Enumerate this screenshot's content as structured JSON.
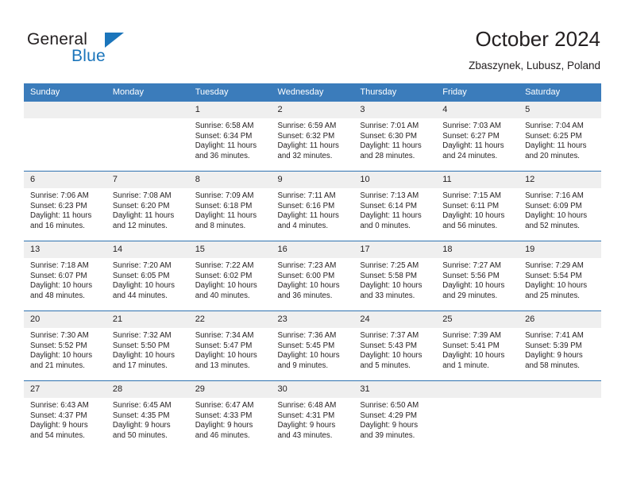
{
  "brand": {
    "name_top": "General",
    "name_bottom": "Blue",
    "accent_color": "#1b75bb"
  },
  "header": {
    "title": "October 2024",
    "location": "Zbaszynek, Lubusz, Poland",
    "header_bg_color": "#3b7cbb",
    "row_divider_color": "#2e72b0",
    "daynum_bg_color": "#efefef"
  },
  "weekday_headers": [
    "Sunday",
    "Monday",
    "Tuesday",
    "Wednesday",
    "Thursday",
    "Friday",
    "Saturday"
  ],
  "labels": {
    "sunrise": "Sunrise:",
    "sunset": "Sunset:",
    "daylight": "Daylight:"
  },
  "weeks": [
    [
      {
        "day": "",
        "empty": true,
        "sunrise": "",
        "sunset": "",
        "daylight_line1": "",
        "daylight_line2": ""
      },
      {
        "day": "",
        "empty": true,
        "sunrise": "",
        "sunset": "",
        "daylight_line1": "",
        "daylight_line2": ""
      },
      {
        "day": "1",
        "empty": false,
        "sunrise": "Sunrise: 6:58 AM",
        "sunset": "Sunset: 6:34 PM",
        "daylight_line1": "Daylight: 11 hours",
        "daylight_line2": "and 36 minutes."
      },
      {
        "day": "2",
        "empty": false,
        "sunrise": "Sunrise: 6:59 AM",
        "sunset": "Sunset: 6:32 PM",
        "daylight_line1": "Daylight: 11 hours",
        "daylight_line2": "and 32 minutes."
      },
      {
        "day": "3",
        "empty": false,
        "sunrise": "Sunrise: 7:01 AM",
        "sunset": "Sunset: 6:30 PM",
        "daylight_line1": "Daylight: 11 hours",
        "daylight_line2": "and 28 minutes."
      },
      {
        "day": "4",
        "empty": false,
        "sunrise": "Sunrise: 7:03 AM",
        "sunset": "Sunset: 6:27 PM",
        "daylight_line1": "Daylight: 11 hours",
        "daylight_line2": "and 24 minutes."
      },
      {
        "day": "5",
        "empty": false,
        "sunrise": "Sunrise: 7:04 AM",
        "sunset": "Sunset: 6:25 PM",
        "daylight_line1": "Daylight: 11 hours",
        "daylight_line2": "and 20 minutes."
      }
    ],
    [
      {
        "day": "6",
        "empty": false,
        "sunrise": "Sunrise: 7:06 AM",
        "sunset": "Sunset: 6:23 PM",
        "daylight_line1": "Daylight: 11 hours",
        "daylight_line2": "and 16 minutes."
      },
      {
        "day": "7",
        "empty": false,
        "sunrise": "Sunrise: 7:08 AM",
        "sunset": "Sunset: 6:20 PM",
        "daylight_line1": "Daylight: 11 hours",
        "daylight_line2": "and 12 minutes."
      },
      {
        "day": "8",
        "empty": false,
        "sunrise": "Sunrise: 7:09 AM",
        "sunset": "Sunset: 6:18 PM",
        "daylight_line1": "Daylight: 11 hours",
        "daylight_line2": "and 8 minutes."
      },
      {
        "day": "9",
        "empty": false,
        "sunrise": "Sunrise: 7:11 AM",
        "sunset": "Sunset: 6:16 PM",
        "daylight_line1": "Daylight: 11 hours",
        "daylight_line2": "and 4 minutes."
      },
      {
        "day": "10",
        "empty": false,
        "sunrise": "Sunrise: 7:13 AM",
        "sunset": "Sunset: 6:14 PM",
        "daylight_line1": "Daylight: 11 hours",
        "daylight_line2": "and 0 minutes."
      },
      {
        "day": "11",
        "empty": false,
        "sunrise": "Sunrise: 7:15 AM",
        "sunset": "Sunset: 6:11 PM",
        "daylight_line1": "Daylight: 10 hours",
        "daylight_line2": "and 56 minutes."
      },
      {
        "day": "12",
        "empty": false,
        "sunrise": "Sunrise: 7:16 AM",
        "sunset": "Sunset: 6:09 PM",
        "daylight_line1": "Daylight: 10 hours",
        "daylight_line2": "and 52 minutes."
      }
    ],
    [
      {
        "day": "13",
        "empty": false,
        "sunrise": "Sunrise: 7:18 AM",
        "sunset": "Sunset: 6:07 PM",
        "daylight_line1": "Daylight: 10 hours",
        "daylight_line2": "and 48 minutes."
      },
      {
        "day": "14",
        "empty": false,
        "sunrise": "Sunrise: 7:20 AM",
        "sunset": "Sunset: 6:05 PM",
        "daylight_line1": "Daylight: 10 hours",
        "daylight_line2": "and 44 minutes."
      },
      {
        "day": "15",
        "empty": false,
        "sunrise": "Sunrise: 7:22 AM",
        "sunset": "Sunset: 6:02 PM",
        "daylight_line1": "Daylight: 10 hours",
        "daylight_line2": "and 40 minutes."
      },
      {
        "day": "16",
        "empty": false,
        "sunrise": "Sunrise: 7:23 AM",
        "sunset": "Sunset: 6:00 PM",
        "daylight_line1": "Daylight: 10 hours",
        "daylight_line2": "and 36 minutes."
      },
      {
        "day": "17",
        "empty": false,
        "sunrise": "Sunrise: 7:25 AM",
        "sunset": "Sunset: 5:58 PM",
        "daylight_line1": "Daylight: 10 hours",
        "daylight_line2": "and 33 minutes."
      },
      {
        "day": "18",
        "empty": false,
        "sunrise": "Sunrise: 7:27 AM",
        "sunset": "Sunset: 5:56 PM",
        "daylight_line1": "Daylight: 10 hours",
        "daylight_line2": "and 29 minutes."
      },
      {
        "day": "19",
        "empty": false,
        "sunrise": "Sunrise: 7:29 AM",
        "sunset": "Sunset: 5:54 PM",
        "daylight_line1": "Daylight: 10 hours",
        "daylight_line2": "and 25 minutes."
      }
    ],
    [
      {
        "day": "20",
        "empty": false,
        "sunrise": "Sunrise: 7:30 AM",
        "sunset": "Sunset: 5:52 PM",
        "daylight_line1": "Daylight: 10 hours",
        "daylight_line2": "and 21 minutes."
      },
      {
        "day": "21",
        "empty": false,
        "sunrise": "Sunrise: 7:32 AM",
        "sunset": "Sunset: 5:50 PM",
        "daylight_line1": "Daylight: 10 hours",
        "daylight_line2": "and 17 minutes."
      },
      {
        "day": "22",
        "empty": false,
        "sunrise": "Sunrise: 7:34 AM",
        "sunset": "Sunset: 5:47 PM",
        "daylight_line1": "Daylight: 10 hours",
        "daylight_line2": "and 13 minutes."
      },
      {
        "day": "23",
        "empty": false,
        "sunrise": "Sunrise: 7:36 AM",
        "sunset": "Sunset: 5:45 PM",
        "daylight_line1": "Daylight: 10 hours",
        "daylight_line2": "and 9 minutes."
      },
      {
        "day": "24",
        "empty": false,
        "sunrise": "Sunrise: 7:37 AM",
        "sunset": "Sunset: 5:43 PM",
        "daylight_line1": "Daylight: 10 hours",
        "daylight_line2": "and 5 minutes."
      },
      {
        "day": "25",
        "empty": false,
        "sunrise": "Sunrise: 7:39 AM",
        "sunset": "Sunset: 5:41 PM",
        "daylight_line1": "Daylight: 10 hours",
        "daylight_line2": "and 1 minute."
      },
      {
        "day": "26",
        "empty": false,
        "sunrise": "Sunrise: 7:41 AM",
        "sunset": "Sunset: 5:39 PM",
        "daylight_line1": "Daylight: 9 hours",
        "daylight_line2": "and 58 minutes."
      }
    ],
    [
      {
        "day": "27",
        "empty": false,
        "sunrise": "Sunrise: 6:43 AM",
        "sunset": "Sunset: 4:37 PM",
        "daylight_line1": "Daylight: 9 hours",
        "daylight_line2": "and 54 minutes."
      },
      {
        "day": "28",
        "empty": false,
        "sunrise": "Sunrise: 6:45 AM",
        "sunset": "Sunset: 4:35 PM",
        "daylight_line1": "Daylight: 9 hours",
        "daylight_line2": "and 50 minutes."
      },
      {
        "day": "29",
        "empty": false,
        "sunrise": "Sunrise: 6:47 AM",
        "sunset": "Sunset: 4:33 PM",
        "daylight_line1": "Daylight: 9 hours",
        "daylight_line2": "and 46 minutes."
      },
      {
        "day": "30",
        "empty": false,
        "sunrise": "Sunrise: 6:48 AM",
        "sunset": "Sunset: 4:31 PM",
        "daylight_line1": "Daylight: 9 hours",
        "daylight_line2": "and 43 minutes."
      },
      {
        "day": "31",
        "empty": false,
        "sunrise": "Sunrise: 6:50 AM",
        "sunset": "Sunset: 4:29 PM",
        "daylight_line1": "Daylight: 9 hours",
        "daylight_line2": "and 39 minutes."
      },
      {
        "day": "",
        "empty": true,
        "sunrise": "",
        "sunset": "",
        "daylight_line1": "",
        "daylight_line2": ""
      },
      {
        "day": "",
        "empty": true,
        "sunrise": "",
        "sunset": "",
        "daylight_line1": "",
        "daylight_line2": ""
      }
    ]
  ]
}
